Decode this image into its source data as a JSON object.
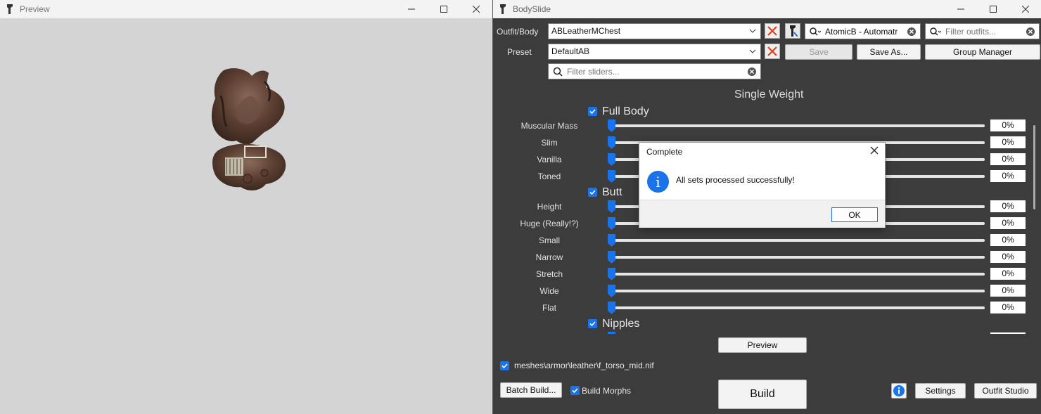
{
  "preview": {
    "title": "Preview"
  },
  "bodyslide": {
    "title": "BodySlide",
    "outfit_label": "Outfit/Body",
    "outfit_value": "ABLeatherMChest",
    "preset_label": "Preset",
    "preset_value": "DefaultAB",
    "group_filter_value": "AtomicB - Automatr",
    "outfit_filter_placeholder": "Filter outfits...",
    "slider_filter_placeholder": "Filter sliders...",
    "save_label": "Save",
    "save_as_label": "Save As...",
    "group_manager_label": "Group Manager",
    "weight_title": "Single Weight",
    "groups": [
      {
        "name": "Full Body",
        "sliders": [
          {
            "name": "Muscular Mass",
            "value": "0%"
          },
          {
            "name": "Slim",
            "value": "0%"
          },
          {
            "name": "Vanilla",
            "value": "0%"
          },
          {
            "name": "Toned",
            "value": "0%"
          }
        ]
      },
      {
        "name": "Butt",
        "sliders": [
          {
            "name": "Height",
            "value": "0%"
          },
          {
            "name": "Huge (Really!?)",
            "value": "0%"
          },
          {
            "name": "Small",
            "value": "0%"
          },
          {
            "name": "Narrow",
            "value": "0%"
          },
          {
            "name": "Stretch",
            "value": "0%"
          },
          {
            "name": "Wide",
            "value": "0%"
          },
          {
            "name": "Flat",
            "value": "0%"
          }
        ]
      },
      {
        "name": "Nipples",
        "sliders": []
      }
    ],
    "preview_button": "Preview",
    "mesh_path": "meshes\\armor\\leather\\f_torso_mid.nif",
    "batch_build_label": "Batch Build...",
    "build_morphs_label": "Build Morphs",
    "build_label": "Build",
    "settings_label": "Settings",
    "outfit_studio_label": "Outfit Studio"
  },
  "dialog": {
    "title": "Complete",
    "message": "All sets processed successfully!",
    "ok_label": "OK"
  },
  "colors": {
    "accent": "#1a73e8",
    "danger": "#e0401a",
    "panel_bg": "#3c3c3c"
  }
}
